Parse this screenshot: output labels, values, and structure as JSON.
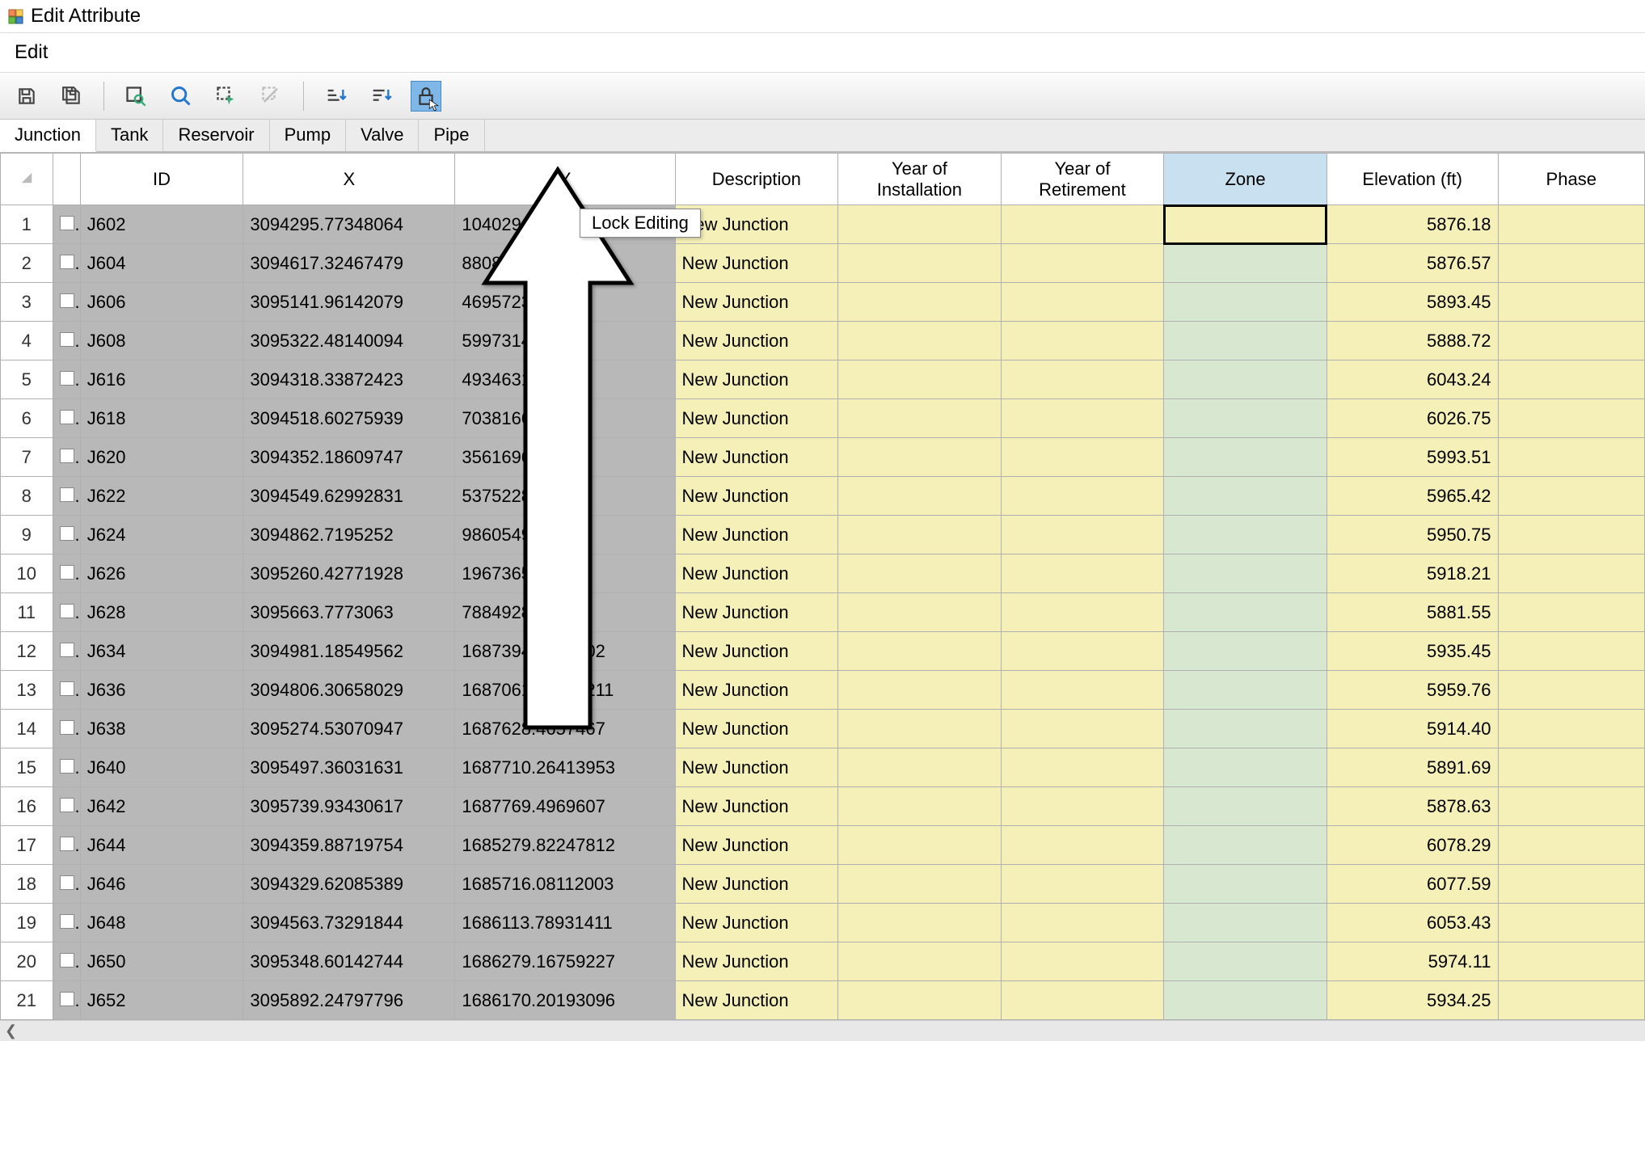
{
  "window": {
    "title": "Edit Attribute"
  },
  "menu": {
    "edit": "Edit"
  },
  "toolbar": {
    "tooltip": "Lock Editing"
  },
  "tabs": [
    "Junction",
    "Tank",
    "Reservoir",
    "Pump",
    "Valve",
    "Pipe"
  ],
  "activeTab": 0,
  "columns": {
    "id": "ID",
    "x": "X",
    "y": "Y",
    "description": "Description",
    "year_install": "Year of\nInstallation",
    "year_retire": "Year of\nRetirement",
    "zone": "Zone",
    "elevation": "Elevation (ft)",
    "phase": "Phase"
  },
  "rows": [
    {
      "n": "1",
      "id": "J602",
      "x": "3094295.77348064",
      "y": "104029",
      "desc": "New Junction",
      "yoi": "",
      "yor": "",
      "zone": "",
      "elev": "5876.18",
      "phase": ""
    },
    {
      "n": "2",
      "id": "J604",
      "x": "3094617.32467479",
      "y": "88087",
      "desc": "New Junction",
      "yoi": "",
      "yor": "",
      "zone": "",
      "elev": "5876.57",
      "phase": ""
    },
    {
      "n": "3",
      "id": "J606",
      "x": "3095141.96142079",
      "y": "46957237",
      "desc": "New Junction",
      "yoi": "",
      "yor": "",
      "zone": "",
      "elev": "5893.45",
      "phase": ""
    },
    {
      "n": "4",
      "id": "J608",
      "x": "3095322.48140094",
      "y": "59973145",
      "desc": "New Junction",
      "yoi": "",
      "yor": "",
      "zone": "",
      "elev": "5888.72",
      "phase": ""
    },
    {
      "n": "5",
      "id": "J616",
      "x": "3094318.33872423",
      "y": "49346311",
      "desc": "New Junction",
      "yoi": "",
      "yor": "",
      "zone": "",
      "elev": "6043.24",
      "phase": ""
    },
    {
      "n": "6",
      "id": "J618",
      "x": "3094518.60275939",
      "y": "70381662",
      "desc": "New Junction",
      "yoi": "",
      "yor": "",
      "zone": "",
      "elev": "6026.75",
      "phase": ""
    },
    {
      "n": "7",
      "id": "J620",
      "x": "3094352.18609747",
      "y": "3561696",
      "desc": "New Junction",
      "yoi": "",
      "yor": "",
      "zone": "",
      "elev": "5993.51",
      "phase": ""
    },
    {
      "n": "8",
      "id": "J622",
      "x": "3094549.62992831",
      "y": "53752287",
      "desc": "New Junction",
      "yoi": "",
      "yor": "",
      "zone": "",
      "elev": "5965.42",
      "phase": ""
    },
    {
      "n": "9",
      "id": "J624",
      "x": "3094862.7195252",
      "y": "98605494",
      "desc": "New Junction",
      "yoi": "",
      "yor": "",
      "zone": "",
      "elev": "5950.75",
      "phase": ""
    },
    {
      "n": "10",
      "id": "J626",
      "x": "3095260.42771928",
      "y": "19673653",
      "desc": "New Junction",
      "yoi": "",
      "yor": "",
      "zone": "",
      "elev": "5918.21",
      "phase": ""
    },
    {
      "n": "11",
      "id": "J628",
      "x": "3095663.7773063",
      "y": "78849287",
      "desc": "New Junction",
      "yoi": "",
      "yor": "",
      "zone": "",
      "elev": "5881.55",
      "phase": ""
    },
    {
      "n": "12",
      "id": "J634",
      "x": "3094981.18549562",
      "y": "1687394.3540102",
      "desc": "New Junction",
      "yoi": "",
      "yor": "",
      "zone": "",
      "elev": "5935.45",
      "phase": ""
    },
    {
      "n": "13",
      "id": "J636",
      "x": "3094806.30658029",
      "y": "1687061.51970211",
      "desc": "New Junction",
      "yoi": "",
      "yor": "",
      "zone": "",
      "elev": "5959.76",
      "phase": ""
    },
    {
      "n": "14",
      "id": "J638",
      "x": "3095274.53070947",
      "y": "1687628.4657467",
      "desc": "New Junction",
      "yoi": "",
      "yor": "",
      "zone": "",
      "elev": "5914.40",
      "phase": ""
    },
    {
      "n": "15",
      "id": "J640",
      "x": "3095497.36031631",
      "y": "1687710.26413953",
      "desc": "New Junction",
      "yoi": "",
      "yor": "",
      "zone": "",
      "elev": "5891.69",
      "phase": ""
    },
    {
      "n": "16",
      "id": "J642",
      "x": "3095739.93430617",
      "y": "1687769.4969607",
      "desc": "New Junction",
      "yoi": "",
      "yor": "",
      "zone": "",
      "elev": "5878.63",
      "phase": ""
    },
    {
      "n": "17",
      "id": "J644",
      "x": "3094359.88719754",
      "y": "1685279.82247812",
      "desc": "New Junction",
      "yoi": "",
      "yor": "",
      "zone": "",
      "elev": "6078.29",
      "phase": ""
    },
    {
      "n": "18",
      "id": "J646",
      "x": "3094329.62085389",
      "y": "1685716.08112003",
      "desc": "New Junction",
      "yoi": "",
      "yor": "",
      "zone": "",
      "elev": "6077.59",
      "phase": ""
    },
    {
      "n": "19",
      "id": "J648",
      "x": "3094563.73291844",
      "y": "1686113.78931411",
      "desc": "New Junction",
      "yoi": "",
      "yor": "",
      "zone": "",
      "elev": "6053.43",
      "phase": ""
    },
    {
      "n": "20",
      "id": "J650",
      "x": "3095348.60142744",
      "y": "1686279.16759227",
      "desc": "New Junction",
      "yoi": "",
      "yor": "",
      "zone": "",
      "elev": "5974.11",
      "phase": ""
    },
    {
      "n": "21",
      "id": "J652",
      "x": "3095892.24797796",
      "y": "1686170.20193096",
      "desc": "New Junction",
      "yoi": "",
      "yor": "",
      "zone": "",
      "elev": "5934.25",
      "phase": ""
    }
  ],
  "selectedCell": {
    "row": 0,
    "col": "zone"
  }
}
